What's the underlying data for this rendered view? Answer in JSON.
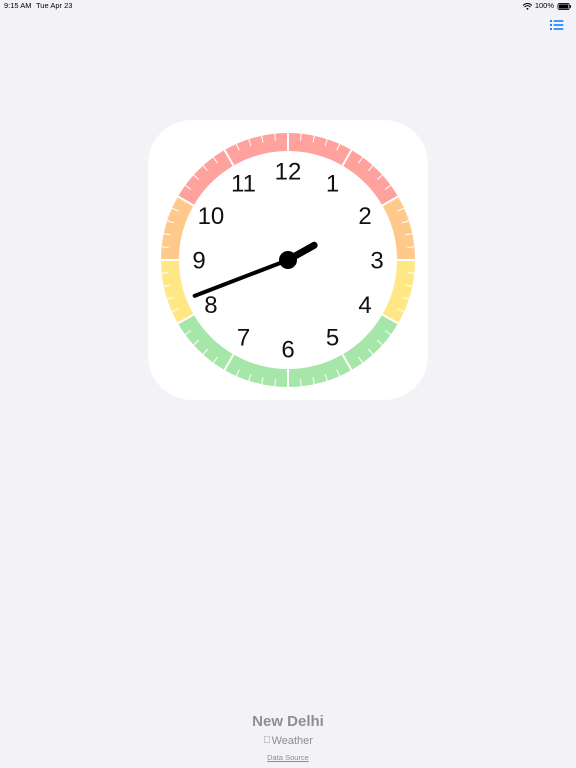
{
  "status_bar": {
    "time": "9:15 AM",
    "date": "Tue Apr 23",
    "battery": "100%",
    "battery_level": 1.0,
    "wifi_icon": "wifi-icon",
    "battery_icon": "battery-full-icon"
  },
  "toolbar": {
    "list_icon": "list-icon",
    "accent_color": "#007aff"
  },
  "clock": {
    "numerals": [
      "12",
      "1",
      "2",
      "3",
      "4",
      "5",
      "6",
      "7",
      "8",
      "9",
      "10",
      "11"
    ],
    "hour_hand_hours": 2.02,
    "minute_hand_minutes": 41.5,
    "bands": [
      {
        "from_hour": 10,
        "to_hour": 2,
        "color": "#ffa19c"
      },
      {
        "from_hour": 2,
        "to_hour": 3,
        "color": "#ffc98c"
      },
      {
        "from_hour": 3,
        "to_hour": 4,
        "color": "#ffe785"
      },
      {
        "from_hour": 4,
        "to_hour": 8,
        "color": "#a6e6a9"
      },
      {
        "from_hour": 8,
        "to_hour": 9,
        "color": "#ffe785"
      },
      {
        "from_hour": 9,
        "to_hour": 10,
        "color": "#ffc98c"
      }
    ],
    "hand_color": "#000000"
  },
  "location": {
    "city": "New Delhi"
  },
  "attribution": {
    "brand": "Weather",
    "apple_icon": "apple-logo-icon",
    "data_source": "Data Source"
  }
}
